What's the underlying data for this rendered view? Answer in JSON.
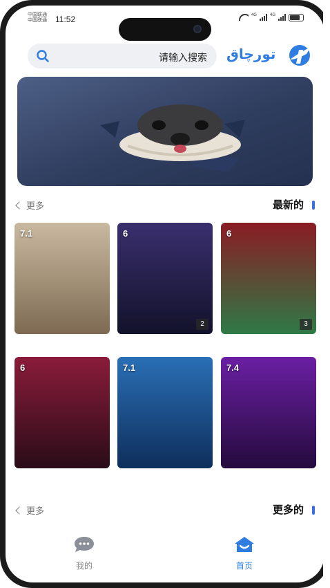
{
  "status": {
    "carrier_1": "中国联通",
    "carrier_2": "中国联通",
    "time": "11:52",
    "network_1": "4G",
    "network_2": "4G"
  },
  "header": {
    "search_placeholder": "请输入搜索",
    "logo_text": "تورچاق",
    "icons": {
      "search": "search-icon",
      "logo": "app-logo-icon"
    }
  },
  "banner": {
    "icon": "banner-image"
  },
  "section_latest": {
    "title": "最新的",
    "more": "更多"
  },
  "section_more": {
    "title": "更多的",
    "more": "更多"
  },
  "videos": [
    {
      "rating": "7.1",
      "episode": "",
      "colors": [
        "#c9b9a0",
        "#7e6a52"
      ]
    },
    {
      "rating": "6",
      "episode": "2",
      "colors": [
        "#3a2f6e",
        "#12122a"
      ]
    },
    {
      "rating": "6",
      "episode": "3",
      "colors": [
        "#8a1c24",
        "#2f7a46"
      ]
    },
    {
      "rating": "6",
      "episode": "",
      "colors": [
        "#8a1c3a",
        "#2a0c18"
      ]
    },
    {
      "rating": "7.1",
      "episode": "",
      "colors": [
        "#2a6fb5",
        "#0e2f5c"
      ]
    },
    {
      "rating": "7.4",
      "episode": "",
      "colors": [
        "#6a1fa3",
        "#250b3d"
      ]
    }
  ],
  "tabs": {
    "mine": "我的",
    "home": "首页"
  },
  "colors": {
    "accent": "#2f7de1",
    "section_bar": "#3b6fe0"
  }
}
